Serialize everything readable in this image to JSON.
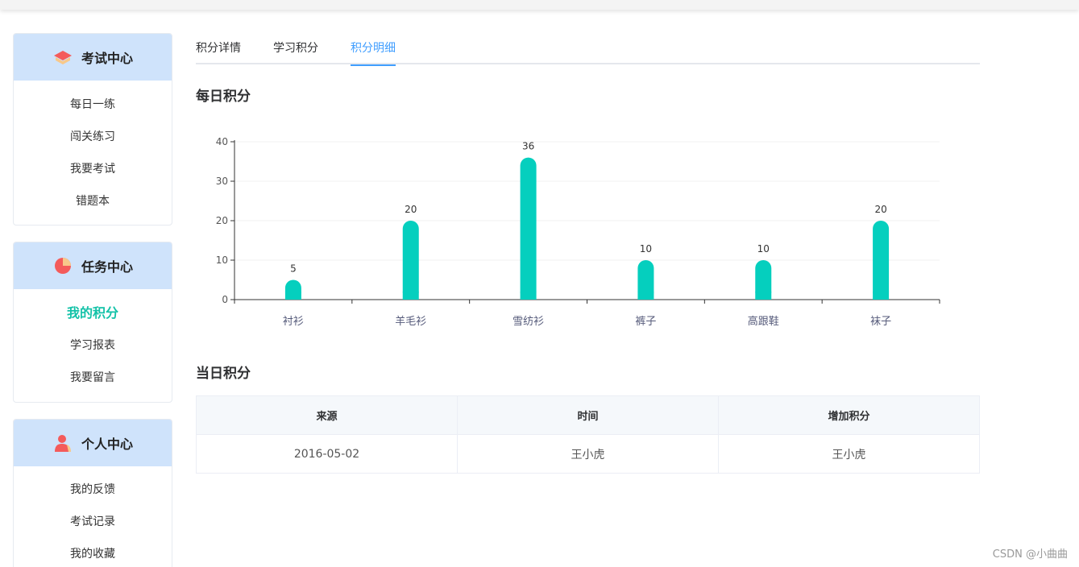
{
  "sidebar": {
    "exam": {
      "title": "考试中心",
      "items": [
        "每日一练",
        "闯关练习",
        "我要考试",
        "错题本"
      ]
    },
    "task": {
      "title": "任务中心",
      "items": [
        "我的积分",
        "学习报表",
        "我要留言"
      ],
      "active_index": 0
    },
    "personal": {
      "title": "个人中心",
      "items": [
        "我的反馈",
        "考试记录",
        "我的收藏"
      ]
    }
  },
  "tabs": [
    {
      "label": "积分详情"
    },
    {
      "label": "学习积分"
    },
    {
      "label": "积分明细"
    }
  ],
  "active_tab": 2,
  "sections": {
    "daily_title": "每日积分",
    "today_title": "当日积分"
  },
  "chart_data": {
    "type": "bar",
    "categories": [
      "衬衫",
      "羊毛衫",
      "雪纺衫",
      "裤子",
      "高跟鞋",
      "袜子"
    ],
    "values": [
      5,
      20,
      36,
      10,
      10,
      20
    ],
    "ylim": [
      0,
      40
    ],
    "yticks": [
      0,
      10,
      20,
      30,
      40
    ],
    "title": "",
    "xlabel": "",
    "ylabel": "",
    "bar_color": "#05cfbe",
    "grid": true
  },
  "table": {
    "headers": [
      "来源",
      "时间",
      "增加积分"
    ],
    "rows": [
      [
        "2016-05-02",
        "王小虎",
        "王小虎"
      ]
    ]
  },
  "colors": {
    "header_bg": "#cfe3fb",
    "active_menu": "#13c2a8",
    "active_tab": "#409eff"
  },
  "watermark": "CSDN @小曲曲"
}
